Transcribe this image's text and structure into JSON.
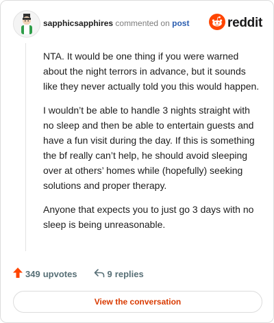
{
  "header": {
    "username": "sapphicsapphires",
    "action_text": "commented on",
    "post_link": "post",
    "brand_wordmark": "reddit"
  },
  "comment": {
    "paragraphs": [
      "NTA. It would be one thing if you were warned about the night terrors in advance, but it sounds like they never actually told you this would happen.",
      "I wouldn’t be able to handle 3 nights straight with no sleep and then be able to entertain guests and have a fun visit during the day. If this is something the bf really can’t help, he should avoid sleeping over at others’ homes while (hopefully) seeking solutions and proper therapy.",
      "Anyone that expects you to just go 3 days with no sleep is being unreasonable."
    ]
  },
  "footer": {
    "upvotes_count": "349",
    "upvotes_label": "upvotes",
    "replies_count": "9",
    "replies_label": "replies"
  },
  "cta": {
    "label": "View the conversation"
  },
  "colors": {
    "brand_orange": "#ff4500",
    "cta_text": "#d93a00",
    "upvote_arrow": "#ff4500",
    "link_blue": "#2a5db0",
    "muted": "#7c7c7c"
  },
  "icons": {
    "avatar": "user-avatar-icon",
    "brand": "reddit-snoo-icon",
    "upvote": "upvote-arrow-icon",
    "reply": "reply-arrow-icon"
  }
}
